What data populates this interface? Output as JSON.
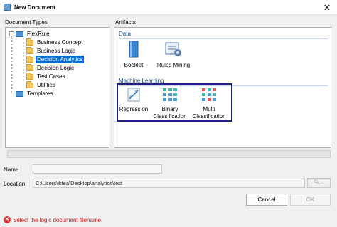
{
  "window": {
    "title": "New Document",
    "close_glyph": "✕"
  },
  "document_types": {
    "label": "Document Types",
    "root": "FlexRule",
    "items": [
      "Business Concept",
      "Business Logic",
      "Decision Analytics",
      "Decision Logic",
      "Test Cases",
      "Utilities"
    ],
    "selected": "Decision Analytics",
    "templates": "Templates"
  },
  "artifacts": {
    "label": "Artifacts",
    "groups": [
      {
        "title": "Data",
        "items": [
          "Booklet",
          "Rules Mining"
        ]
      },
      {
        "title": "Machine Learning",
        "items": [
          "Regression",
          "Binary Classification",
          "Multi Classification"
        ]
      }
    ]
  },
  "form": {
    "name_label": "Name",
    "name_value": "",
    "location_label": "Location",
    "location_value": "C:\\Users\\iktea\\Desktop\\analytics\\test",
    "browse_label": "..."
  },
  "buttons": {
    "cancel": "Cancel",
    "ok": "OK"
  },
  "status": {
    "message": "Select the logic document filename.",
    "icon": "error-icon",
    "color": "#cc1d1d"
  },
  "colors": {
    "selection": "#0a6cd2",
    "highlight_box": "#1a237e",
    "group_heading": "#1f4e8c"
  }
}
